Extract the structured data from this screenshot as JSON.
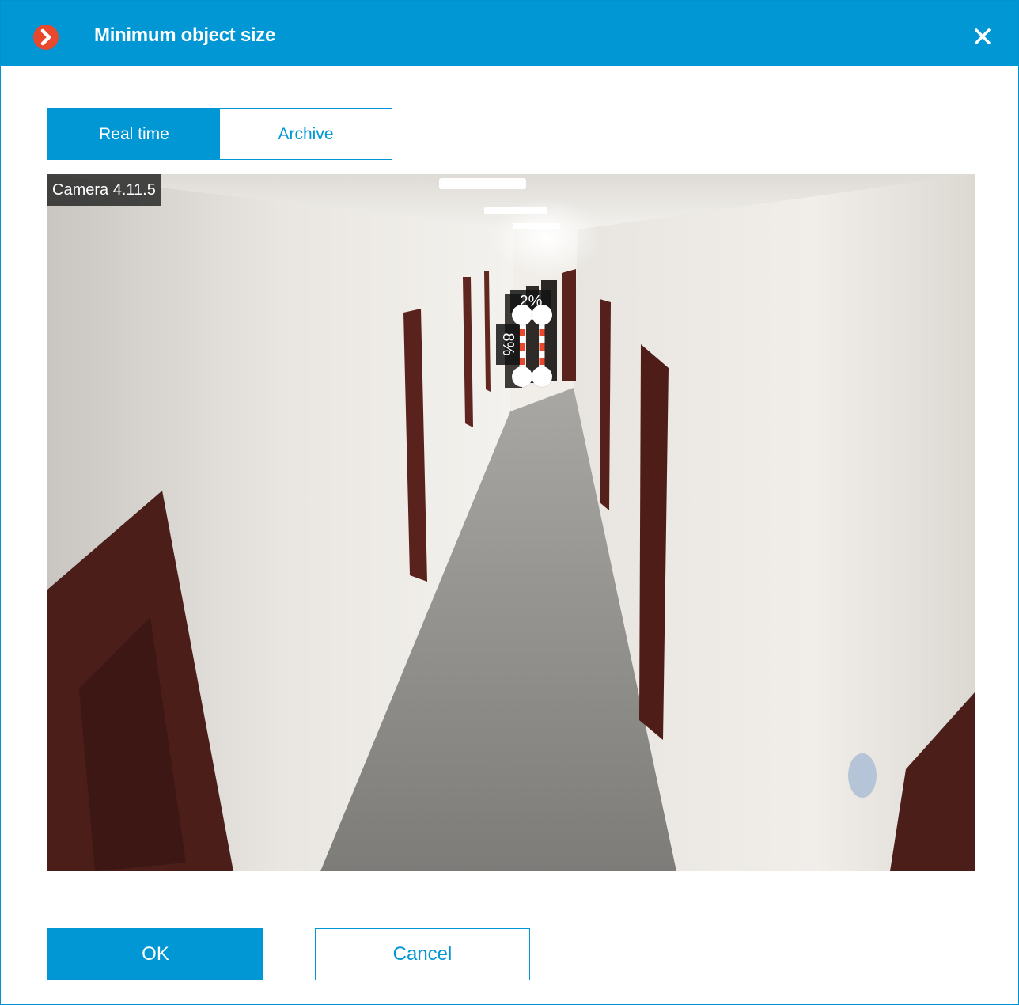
{
  "dialog": {
    "title": "Minimum object size",
    "logo_icon": "app-logo-icon",
    "close_icon": "close-icon"
  },
  "tabs": [
    {
      "label": "Real time",
      "active": true
    },
    {
      "label": "Archive",
      "active": false
    }
  ],
  "video": {
    "camera_label": "Camera 4.11.5",
    "size_tool": {
      "width_percent": "2%",
      "height_percent": "8%"
    }
  },
  "buttons": {
    "ok_label": "OK",
    "cancel_label": "Cancel"
  },
  "colors": {
    "accent": "#0197d4",
    "logo": "#e8492c",
    "measure_stripe": "#e8492c"
  }
}
